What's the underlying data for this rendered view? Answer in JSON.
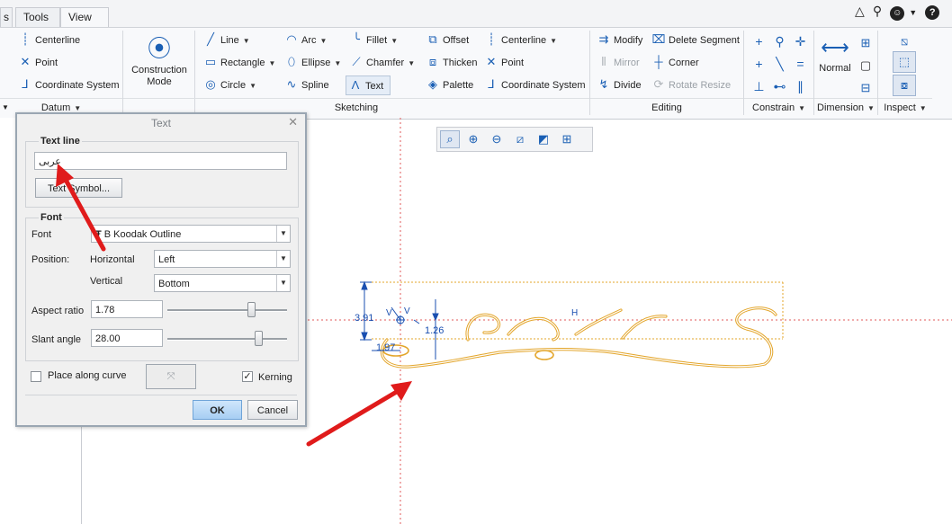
{
  "tabs": [
    {
      "label": "s"
    },
    {
      "label": "Tools"
    },
    {
      "label": "View"
    }
  ],
  "top_icons": [
    "triangle-icon",
    "search-icon",
    "help-globe-icon",
    "help-icon"
  ],
  "ribbon": {
    "datum": {
      "items": [
        "Centerline",
        "Point",
        "Coordinate System"
      ],
      "footer": "Datum"
    },
    "construction_mode": "Construction\nMode",
    "sketching": {
      "col1": [
        {
          "label": "Line",
          "dd": true
        },
        {
          "label": "Rectangle",
          "dd": true
        },
        {
          "label": "Circle",
          "dd": true
        }
      ],
      "col2": [
        {
          "label": "Arc",
          "dd": true
        },
        {
          "label": "Ellipse",
          "dd": true
        },
        {
          "label": "Spline",
          "dd": false
        }
      ],
      "col3": [
        {
          "label": "Fillet",
          "dd": true
        },
        {
          "label": "Chamfer",
          "dd": true
        },
        {
          "label": "Text",
          "dd": false
        }
      ],
      "col4": [
        {
          "label": "Offset"
        },
        {
          "label": "Thicken"
        },
        {
          "label": "Palette"
        }
      ],
      "col5": [
        {
          "label": "Centerline",
          "dd": true
        },
        {
          "label": "Point"
        },
        {
          "label": "Coordinate System"
        }
      ],
      "footer": "Sketching"
    },
    "editing": {
      "col1": [
        {
          "label": "Modify"
        },
        {
          "label": "Mirror",
          "disabled": true
        },
        {
          "label": "Divide"
        }
      ],
      "col2": [
        {
          "label": "Delete Segment"
        },
        {
          "label": "Corner"
        },
        {
          "label": "Rotate Resize",
          "disabled": true
        }
      ],
      "footer": "Editing"
    },
    "constrain": {
      "footer": "Constrain"
    },
    "dimension": {
      "big_label": "Normal",
      "footer": "Dimension"
    },
    "inspect": {
      "footer": "Inspect"
    }
  },
  "dialog": {
    "title": "Text",
    "text_line_legend": "Text line",
    "text_value": "عربی",
    "text_symbol_button": "Text Symbol...",
    "font_legend": "Font",
    "font_label": "Font",
    "font_value": "B Koodak Outline",
    "position_label": "Position:",
    "horizontal_label": "Horizontal",
    "horizontal_value": "Left",
    "vertical_label": "Vertical",
    "vertical_value": "Bottom",
    "aspect_label": "Aspect ratio",
    "aspect_value": "1.78",
    "aspect_slider": 0.72,
    "slant_label": "Slant angle",
    "slant_value": "28.00",
    "slant_slider": 0.78,
    "place_along_curve_label": "Place along curve",
    "place_along_curve_checked": false,
    "kerning_label": "Kerning",
    "kerning_checked": true,
    "ok_label": "OK",
    "cancel_label": "Cancel"
  },
  "sketch": {
    "dims": [
      "3.91",
      "1.97",
      "1.26"
    ],
    "constraint_labels": [
      "V",
      "V",
      "H"
    ],
    "text_color": "#e3a52a",
    "dim_color": "#1a4fb0",
    "arrow_color": "#e01b1b"
  }
}
